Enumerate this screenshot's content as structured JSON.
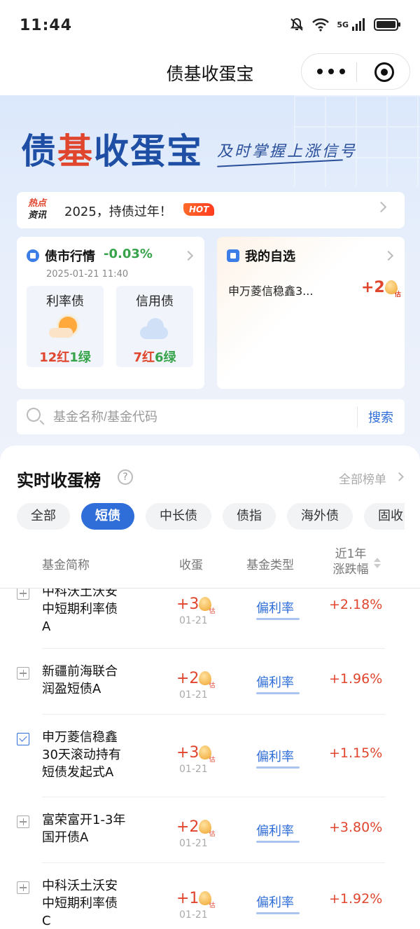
{
  "status_bar": {
    "time": "11:44",
    "network": "5G"
  },
  "nav": {
    "title": "债基收蛋宝"
  },
  "banner": {
    "logo_left": "债",
    "logo_accent": "基",
    "logo_right": "收蛋宝",
    "slogan": "及时掌握上涨信号"
  },
  "news": {
    "tag_line1": "热点",
    "tag_line2": "资讯",
    "text": "2025，持债过年！",
    "badge": "HOT"
  },
  "market": {
    "title": "债市行情",
    "change": "-0.03%",
    "time": "2025-01-21 11:40",
    "rate_bond": {
      "name": "利率债",
      "red": "12",
      "red_label": "红",
      "green": "1",
      "green_label": "绿",
      "weather": "sun-cloud-icon"
    },
    "credit_bond": {
      "name": "信用债",
      "red": "7",
      "red_label": "红",
      "green": "6",
      "green_label": "绿",
      "weather": "cloud-icon"
    }
  },
  "favorites": {
    "title": "我的自选",
    "fund": "申万菱信稳鑫3...",
    "value": "+2",
    "est": "估"
  },
  "search": {
    "placeholder": "基金名称/基金代码",
    "button": "搜索"
  },
  "ranking": {
    "title": "实时收蛋榜",
    "all_label": "全部榜单",
    "tabs": [
      "全部",
      "短债",
      "中长债",
      "债指",
      "海外债",
      "固收+"
    ],
    "active_tab": "短债",
    "headers": {
      "name": "基金简称",
      "egg": "收蛋",
      "type": "基金类型",
      "perf_line1": "近1年",
      "perf_line2": "涨跌幅"
    },
    "rows": [
      {
        "name_line1": "中科沃土沃安",
        "name_line2": "中短期利率债",
        "name_line3": "A",
        "egg": "+3",
        "est": "估",
        "date": "01-21",
        "type": "偏利率",
        "perf": "+2.18%",
        "checked": false
      },
      {
        "name_line1": "新疆前海联合",
        "name_line2": "润盈短债A",
        "name_line3": "",
        "egg": "+2",
        "est": "估",
        "date": "01-21",
        "type": "偏利率",
        "perf": "+1.96%",
        "checked": false
      },
      {
        "name_line1": "申万菱信稳鑫",
        "name_line2": "30天滚动持有",
        "name_line3": "短债发起式A",
        "egg": "+3",
        "est": "估",
        "date": "01-21",
        "type": "偏利率",
        "perf": "+1.15%",
        "checked": true
      },
      {
        "name_line1": "富荣富开1-3年",
        "name_line2": "国开债A",
        "name_line3": "",
        "egg": "+2",
        "est": "估",
        "date": "01-21",
        "type": "偏利率",
        "perf": "+3.80%",
        "checked": false
      },
      {
        "name_line1": "中科沃土沃安",
        "name_line2": "中短期利率债",
        "name_line3": "C",
        "egg": "+1",
        "est": "估",
        "date": "01-21",
        "type": "偏利率",
        "perf": "+1.92%",
        "checked": false
      }
    ]
  },
  "colors": {
    "brand_blue": "#2f6ed8",
    "up_red": "#e0452e",
    "down_green": "#37a34a"
  }
}
